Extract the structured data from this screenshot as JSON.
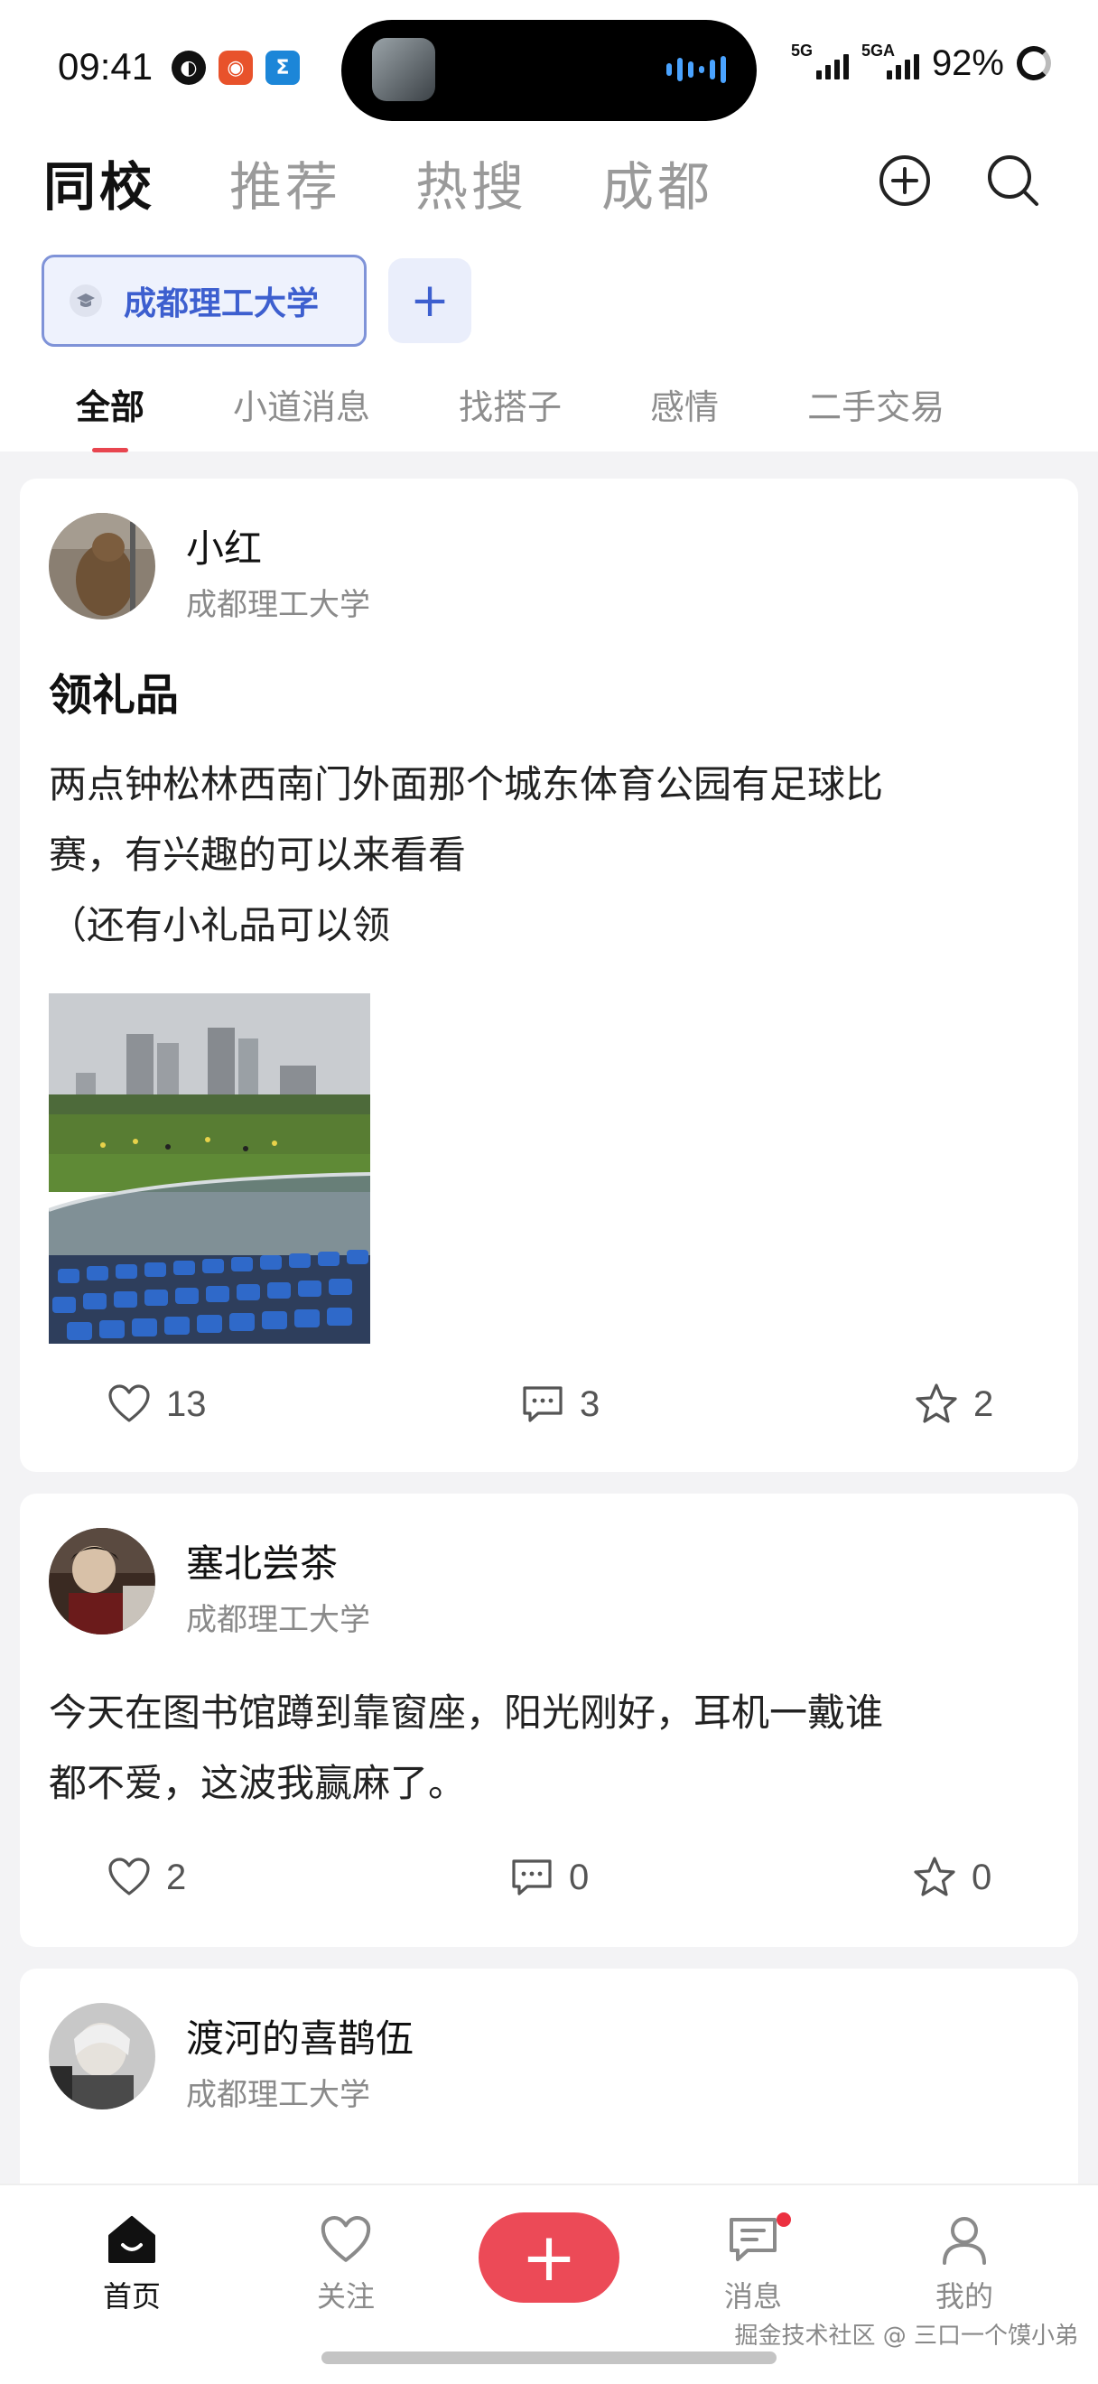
{
  "status_bar": {
    "time": "09:41",
    "signal1_label": "5G",
    "signal2_label": "5GA",
    "battery": "92%"
  },
  "header": {
    "tabs": [
      "同校",
      "推荐",
      "热搜",
      "成都"
    ],
    "active_tab": "同校"
  },
  "school_chip": {
    "name": "成都理工大学",
    "add_label": "+"
  },
  "category_tabs": [
    "全部",
    "小道消息",
    "找搭子",
    "感情",
    "二手交易"
  ],
  "posts": [
    {
      "author": "小红",
      "school": "成都理工大学",
      "title": "领礼品",
      "body": "两点钟松林西南门外面那个城东体育公园有足球比\n赛，有兴趣的可以来看看\n（还有小礼品可以领",
      "likes": "13",
      "comments": "3",
      "favorites": "2"
    },
    {
      "author": "塞北尝茶",
      "school": "成都理工大学",
      "body": "今天在图书馆蹲到靠窗座，阳光刚好，耳机一戴谁\n都不爱，这波我赢麻了。",
      "likes": "2",
      "comments": "0",
      "favorites": "0"
    },
    {
      "author": "渡河的喜鹊伍",
      "school": "成都理工大学"
    }
  ],
  "bottom_nav": {
    "home": "首页",
    "follow": "关注",
    "post": "+",
    "messages": "消息",
    "me": "我的"
  },
  "watermark": "掘金技术社区 @ 三口一个馍小弟",
  "colors": {
    "accent": "#ec4a57",
    "school_blue": "#3d5fcf"
  }
}
